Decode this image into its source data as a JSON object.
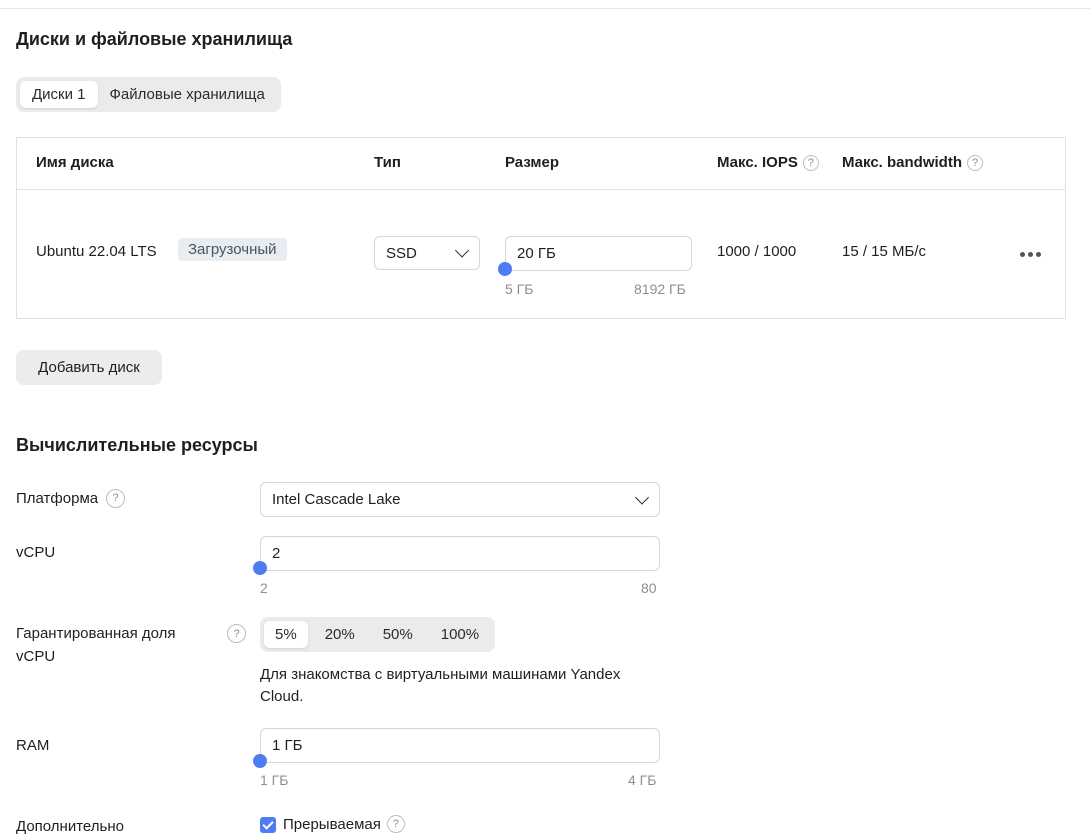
{
  "disks_section": {
    "title": "Диски и файловые хранилища",
    "tabs": [
      {
        "label": "Диски 1",
        "active": true
      },
      {
        "label": "Файловые хранилища",
        "active": false
      }
    ],
    "table": {
      "columns": [
        "Имя диска",
        "Тип",
        "Размер",
        "Макс. IOPS",
        "Макс. bandwidth"
      ],
      "rows": [
        {
          "name": "Ubuntu 22.04 LTS",
          "badge": "Загрузочный",
          "type": "SSD",
          "size": "20 ГБ",
          "size_min": "5 ГБ",
          "size_max": "8192 ГБ",
          "iops": "1000 / 1000",
          "bandwidth": "15 / 15 МБ/с"
        }
      ]
    },
    "add_disk_label": "Добавить диск"
  },
  "compute_section": {
    "title": "Вычислительные ресурсы",
    "platform": {
      "label": "Платформа",
      "value": "Intel Cascade Lake"
    },
    "vcpu": {
      "label": "vCPU",
      "value": "2",
      "min": "2",
      "max": "80"
    },
    "core_fraction": {
      "label_line1": "Гарантированная доля",
      "label_line2": "vCPU",
      "options": [
        "5%",
        "20%",
        "50%",
        "100%"
      ],
      "selected": "5%",
      "hint_line1": "Для знакомства с виртуальными машинами Yandex",
      "hint_line2": "Cloud."
    },
    "ram": {
      "label": "RAM",
      "value": "1 ГБ",
      "min": "1 ГБ",
      "max": "4 ГБ"
    },
    "additional": {
      "label": "Дополнительно",
      "preemptible_label": "Прерываемая",
      "preemptible_checked": true
    }
  },
  "icons": {
    "help": "question-circle-icon",
    "chevron": "chevron-down-icon",
    "more": "more-horizontal-icon",
    "check": "checkmark-icon"
  },
  "colors": {
    "accent": "#4d7cf5",
    "badge_bg": "#e8edf2",
    "button_bg": "#ececec"
  }
}
